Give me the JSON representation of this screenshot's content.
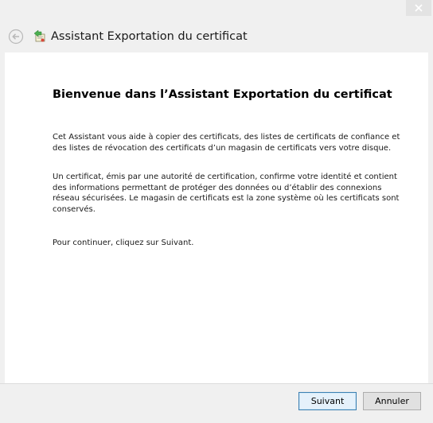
{
  "window": {
    "close_icon": "close-icon"
  },
  "header": {
    "back_icon": "back-arrow-icon",
    "wizard_icon": "certificate-export-icon",
    "title": "Assistant Exportation du certificat"
  },
  "main": {
    "heading": "Bienvenue dans l’Assistant Exportation du certificat",
    "paragraphs": [
      "Cet Assistant vous aide à copier des certificats, des listes de certificats de confiance et des listes de révocation des certificats d’un magasin de certificats vers votre disque.",
      "Un certificat, émis par une autorité de certification, confirme votre identité et contient des informations permettant de protéger des données ou d’établir des connexions réseau sécurisées. Le magasin de certificats est la zone système où les certificats sont conservés.",
      "Pour continuer, cliquez sur Suivant."
    ]
  },
  "footer": {
    "next_label": "Suivant",
    "cancel_label": "Annuler"
  },
  "colors": {
    "content_bg": "#ffffff",
    "chrome_bg": "#f0f0f0",
    "default_button_border": "#3c7fb1"
  }
}
